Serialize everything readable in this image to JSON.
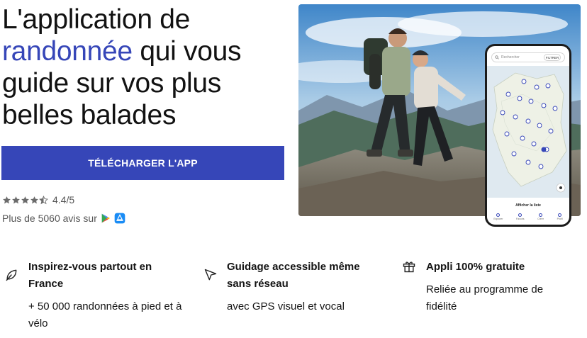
{
  "hero": {
    "title_line1": "L'application de",
    "title_accent": "randonnée",
    "title_rest": " qui vous guide sur vos plus belles balades",
    "download_button": "TÉLÉCHARGER L'APP",
    "rating": "4.4/5",
    "rating_stars": 4.5,
    "reviews": "Plus de 5060 avis sur"
  },
  "phone": {
    "search_placeholder": "Rechercher",
    "filter_label": "FILTRER",
    "list_link": "Afficher la liste",
    "nav": [
      "Explorer",
      "Favoris",
      "Créer",
      "Profil"
    ]
  },
  "features": [
    {
      "icon": "leaf-icon",
      "title": "Inspirez-vous partout en France",
      "description": "+ 50 000 randonnées à pied et à vélo"
    },
    {
      "icon": "navigation-arrow-icon",
      "title": "Guidage accessible même sans réseau",
      "description": "avec GPS visuel et vocal"
    },
    {
      "icon": "gift-icon",
      "title": "Appli 100% gratuite",
      "description": "Reliée au programme de fidélité"
    }
  ],
  "colors": {
    "accent": "#3646b8",
    "text": "#121212",
    "muted": "#555555"
  }
}
